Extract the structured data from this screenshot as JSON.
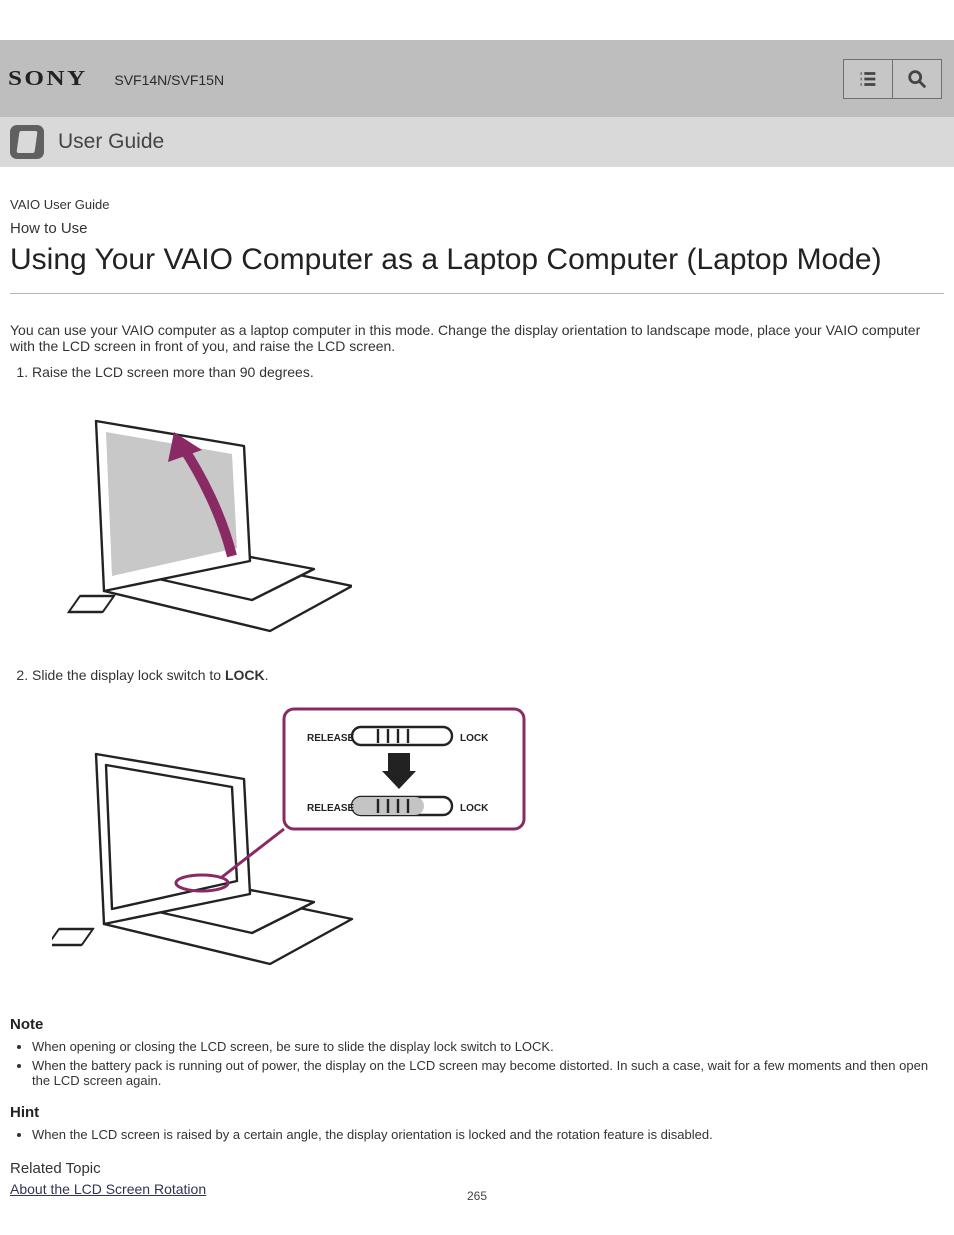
{
  "header": {
    "brand": "SONY",
    "model": "SVF14N/SVF15N",
    "list_label": "List",
    "search_label": "Search",
    "subtitle": "User Guide"
  },
  "content": {
    "guide": "VAIO User Guide",
    "how": "How to Use",
    "title": "Using Your VAIO Computer as a Laptop Computer (Laptop Mode)",
    "intro": "You can use your VAIO computer as a laptop computer in this mode. Change the display orientation to landscape mode, place your VAIO computer with the LCD screen in front of you, and raise the LCD screen.",
    "steps": [
      {
        "label": "Raise the LCD screen more than 90 degrees.",
        "bold_word": "",
        "extra": ""
      },
      {
        "label": "Slide the display lock switch to ",
        "bold_word": "LOCK",
        "extra": "."
      }
    ],
    "notes_title": "Note",
    "notes": [
      "When opening or closing the LCD screen, be sure to slide the display lock switch to LOCK.",
      "When the battery pack is running out of power, the display on the LCD screen may become distorted. In such a case, wait for a few moments and then open the LCD screen again."
    ],
    "hint_title": "Hint",
    "hints": [
      "When the LCD screen is raised by a certain angle, the display orientation is locked and the rotation feature is disabled."
    ],
    "related_title": "Related Topic",
    "related_link": "About the LCD Screen Rotation"
  },
  "footer": {
    "page": "265"
  },
  "switch": {
    "release": "RELEASE",
    "lock": "LOCK"
  }
}
